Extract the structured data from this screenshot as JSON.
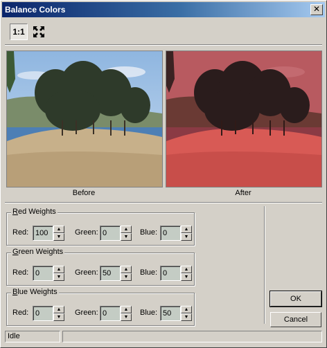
{
  "window": {
    "title": "Balance Colors",
    "close_glyph": "✕"
  },
  "toolbar": {
    "zoom_1to1_label": "1:1",
    "fit_icon": "fit-to-window-icon"
  },
  "preview": {
    "before_label": "Before",
    "after_label": "After"
  },
  "groups": {
    "red": {
      "legend_first": "R",
      "legend_rest": "ed Weights",
      "red_label": "Red:",
      "green_label": "Green:",
      "blue_label": "Blue:",
      "red": "100",
      "green": "0",
      "blue": "0"
    },
    "green": {
      "legend_first": "G",
      "legend_rest": "reen Weights",
      "red_label": "Red:",
      "green_label": "Green:",
      "blue_label": "Blue:",
      "red": "0",
      "green": "50",
      "blue": "0"
    },
    "blue": {
      "legend_first": "B",
      "legend_rest": "lue Weights",
      "red_label": "Red:",
      "green_label": "Green:",
      "blue_label": "Blue:",
      "red": "0",
      "green": "0",
      "blue": "50"
    }
  },
  "buttons": {
    "ok": "OK",
    "cancel": "Cancel"
  },
  "status": {
    "text": "Idle"
  },
  "colors": {
    "title_start": "#0a246a",
    "title_end": "#a6caf0",
    "face": "#d4d0c8",
    "after_tint": "#d85a55"
  }
}
